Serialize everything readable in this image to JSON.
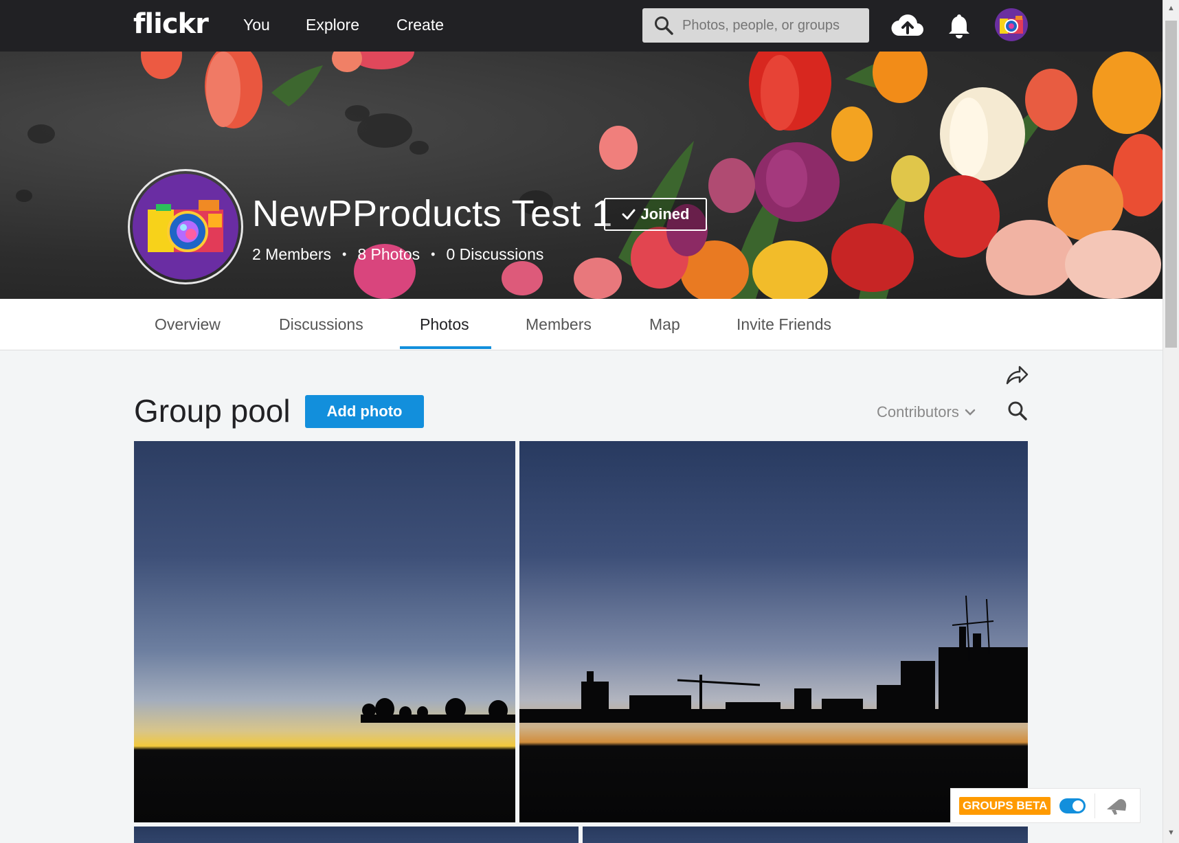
{
  "app": {
    "logo_text": "flickr",
    "brand_color": "#128fdc",
    "accent_orange": "#ff9a00"
  },
  "topnav": {
    "links": [
      "You",
      "Explore",
      "Create"
    ],
    "search_placeholder": "Photos, people, or groups",
    "icons": [
      "search-icon",
      "upload-cloud-icon",
      "notification-bell-icon",
      "user-avatar"
    ]
  },
  "group": {
    "title": "NewPProducts Test 1",
    "joined_label": "Joined",
    "members": "2 Members",
    "photos": "8 Photos",
    "discussions": "0 Discussions",
    "dot": "•"
  },
  "tabs": {
    "items": [
      "Overview",
      "Discussions",
      "Photos",
      "Members",
      "Map",
      "Invite Friends"
    ],
    "active": "Photos"
  },
  "pool": {
    "title": "Group pool",
    "add_photo_label": "Add photo",
    "sort_label": "Contributors"
  },
  "widget": {
    "beta_label": "GROUPS BETA",
    "toggle_on": true
  }
}
